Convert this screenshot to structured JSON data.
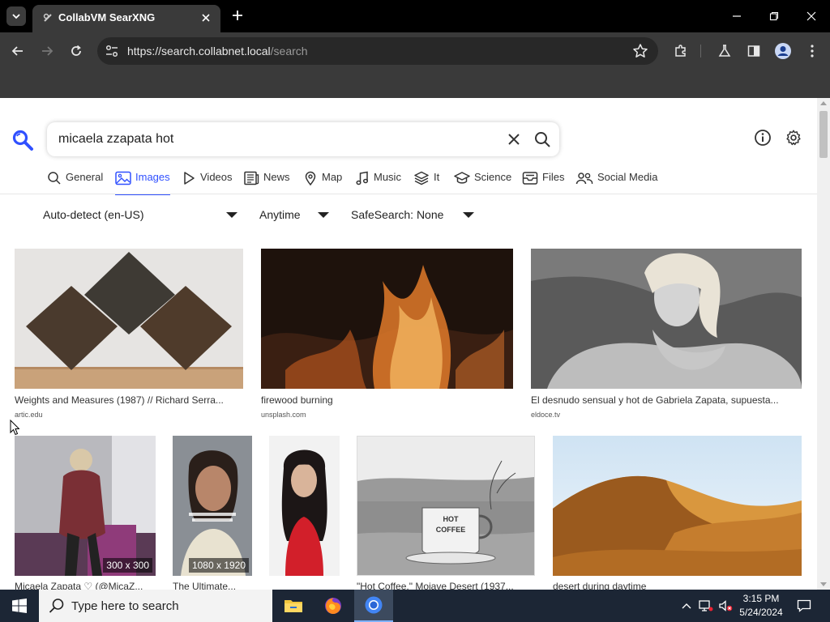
{
  "browser": {
    "tab_title": "CollabVM SearXNG",
    "url_host": "https://search.collabnet.local",
    "url_path": "/search"
  },
  "search": {
    "query": "micaela zzapata hot"
  },
  "categories": [
    {
      "label": "General",
      "icon": "search-icon"
    },
    {
      "label": "Images",
      "icon": "image-icon",
      "active": true
    },
    {
      "label": "Videos",
      "icon": "play-icon"
    },
    {
      "label": "News",
      "icon": "newspaper-icon"
    },
    {
      "label": "Map",
      "icon": "map-pin-icon"
    },
    {
      "label": "Music",
      "icon": "music-note-icon"
    },
    {
      "label": "It",
      "icon": "layers-icon"
    },
    {
      "label": "Science",
      "icon": "graduation-cap-icon"
    },
    {
      "label": "Files",
      "icon": "inbox-icon"
    },
    {
      "label": "Social Media",
      "icon": "people-icon"
    }
  ],
  "filters": {
    "language": "Auto-detect (en-US)",
    "time": "Anytime",
    "safesearch": "SafeSearch: None"
  },
  "results": [
    {
      "title": "Weights and Measures (1987) // Richard Serra...",
      "source": "artic.edu"
    },
    {
      "title": "firewood burning",
      "source": "unsplash.com"
    },
    {
      "title": "El desnudo sensual y hot de Gabriela Zapata, supuesta...",
      "source": "eldoce.tv"
    },
    {
      "title": "Micaela Zapata ♡ (@MicaZ...",
      "dims": "300 x 300"
    },
    {
      "title": "The Ultimate...",
      "dims": "1080 x 1920"
    },
    {
      "title": ""
    },
    {
      "title": "\"Hot Coffee,\" Mojave Desert (1937..."
    },
    {
      "title": "desert during daytime"
    }
  ],
  "taskbar": {
    "search_placeholder": "Type here to search",
    "time": "3:15 PM",
    "date": "5/24/2024"
  }
}
